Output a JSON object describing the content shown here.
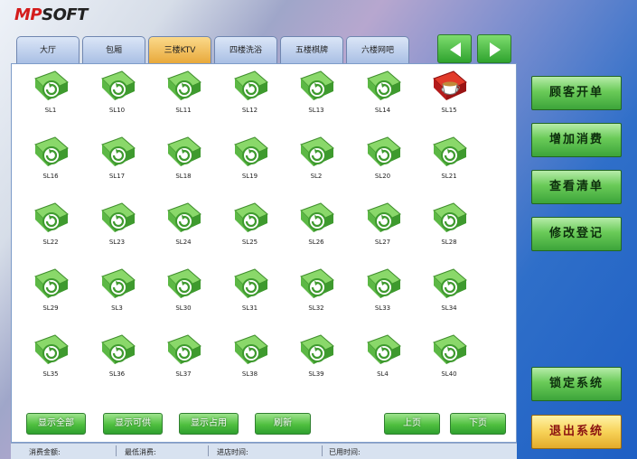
{
  "logo": {
    "red": "MP",
    "black": "SOFT"
  },
  "tabs": [
    "大厅",
    "包厢",
    "三楼KTV",
    "四楼洗浴",
    "五楼棋牌",
    "六楼网吧"
  ],
  "active_tab": "三楼KTV",
  "rooms": [
    [
      "SL1",
      "SL10",
      "SL11",
      "SL12",
      "SL13",
      "SL14",
      "SL15"
    ],
    [
      "SL16",
      "SL17",
      "SL18",
      "SL19",
      "SL2",
      "SL20",
      "SL21"
    ],
    [
      "SL22",
      "SL23",
      "SL24",
      "SL25",
      "SL26",
      "SL27",
      "SL28"
    ],
    [
      "SL29",
      "SL3",
      "SL30",
      "SL31",
      "SL32",
      "SL33",
      "SL34"
    ],
    [
      "SL35",
      "SL36",
      "SL37",
      "SL38",
      "SL39",
      "SL4",
      "SL40"
    ]
  ],
  "occupied_room": "SL15",
  "bottom_buttons": {
    "show_all": "显示全部",
    "show_available": "显示可供",
    "show_occupied": "显示占用",
    "refresh": "刷新",
    "prev_page": "上页",
    "next_page": "下页"
  },
  "side_buttons": {
    "open": "顾客开单",
    "add": "增加消费",
    "view": "查看清单",
    "modify": "修改登记",
    "lock": "锁定系统",
    "exit": "退出系统"
  },
  "status_bar": {
    "amount": "消费金额:",
    "min": "最低消费:",
    "checkin": "进店时间:",
    "used": "已用时间:"
  },
  "colors": {
    "free": "#6cc84e",
    "occupied": "#d42020",
    "accent": "#f0b540"
  }
}
